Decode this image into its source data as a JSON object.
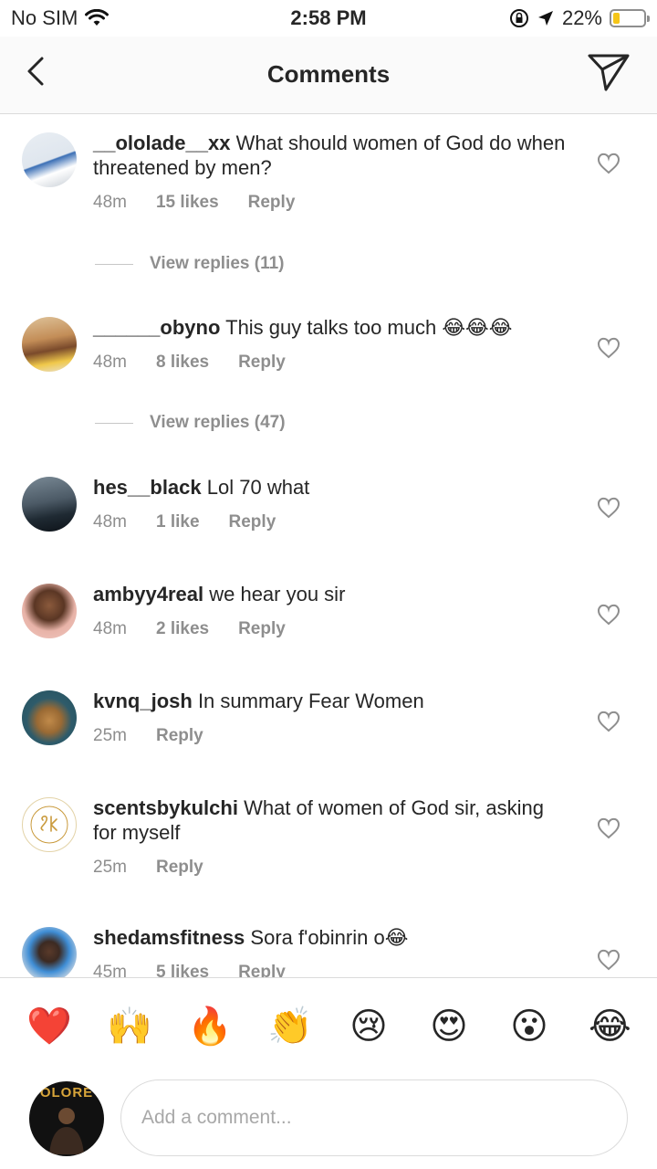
{
  "status_bar": {
    "carrier": "No SIM",
    "time": "2:58 PM",
    "battery": "22%",
    "battery_level": 0.22
  },
  "header": {
    "title": "Comments"
  },
  "comments": [
    {
      "username": "__ololade__xx",
      "text": "What should women of God do when threatened by men?",
      "time": "48m",
      "likes": "15 likes",
      "reply": "Reply",
      "view_replies": "View replies (11)"
    },
    {
      "username": "______obyno",
      "text": "This guy talks too much 😂😂😂",
      "time": "48m",
      "likes": "8 likes",
      "reply": "Reply",
      "view_replies": "View replies (47)"
    },
    {
      "username": "hes__black",
      "text": "Lol 70 what",
      "time": "48m",
      "likes": "1 like",
      "reply": "Reply"
    },
    {
      "username": "ambyy4real",
      "text": "we hear you sir",
      "time": "48m",
      "likes": "2 likes",
      "reply": "Reply"
    },
    {
      "username": "kvnq_josh",
      "text": "In summary Fear Women",
      "time": "25m",
      "reply": "Reply"
    },
    {
      "username": "scentsbykulchi",
      "text": "What of women of God sir, asking for myself",
      "time": "25m",
      "reply": "Reply"
    },
    {
      "username": "shedamsfitness",
      "text": "Sora f'obinrin o😂",
      "time": "45m",
      "likes": "5 likes",
      "reply": "Reply"
    }
  ],
  "reactions": [
    "❤️",
    "🙌",
    "🔥",
    "👏",
    "😢",
    "😍",
    "😮",
    "😂"
  ],
  "composer": {
    "placeholder": "Add a comment...",
    "avatar_text": "OLORE"
  },
  "colors": {
    "text": "#262626",
    "secondary": "#8e8e8e",
    "heart_red": "#ed4956",
    "battery": "#f5c518"
  }
}
